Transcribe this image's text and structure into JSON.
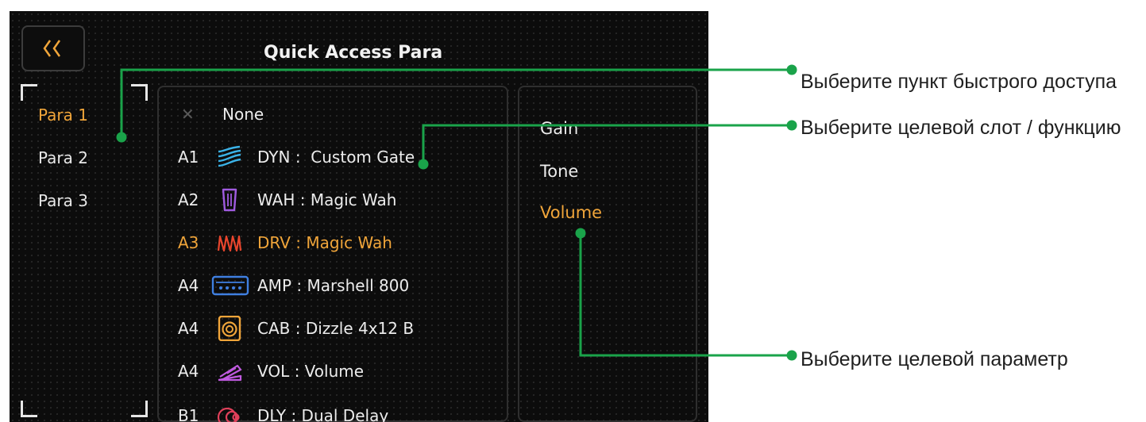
{
  "header": {
    "title": "Quick Access Para",
    "back_label": "‹‹"
  },
  "para_items": [
    {
      "label": "Para 1",
      "selected": true
    },
    {
      "label": "Para 2",
      "selected": false
    },
    {
      "label": "Para 3",
      "selected": false
    }
  ],
  "slots": [
    {
      "code": "",
      "icon": "close-icon",
      "name": "None",
      "selected": false
    },
    {
      "code": "A1",
      "icon": "dyn-wave-icon",
      "name": "DYN :  Custom Gate",
      "selected": false
    },
    {
      "code": "A2",
      "icon": "wah-pedal-icon",
      "name": "WAH : Magic Wah",
      "selected": false
    },
    {
      "code": "A3",
      "icon": "drv-zigzag-icon",
      "name": "DRV : Magic Wah",
      "selected": true
    },
    {
      "code": "A4",
      "icon": "amp-icon",
      "name": "AMP : Marshell 800",
      "selected": false
    },
    {
      "code": "A4",
      "icon": "cab-speaker-icon",
      "name": "CAB : Dizzle 4x12 B",
      "selected": false
    },
    {
      "code": "A4",
      "icon": "vol-pedal-icon",
      "name": "VOL : Volume",
      "selected": false
    },
    {
      "code": "B1",
      "icon": "dly-circles-icon",
      "name": "DLY : Dual Delay",
      "selected": false
    }
  ],
  "params": [
    {
      "label": "Gain",
      "selected": false
    },
    {
      "label": "Tone",
      "selected": false
    },
    {
      "label": "Volume",
      "selected": true
    }
  ],
  "callouts": {
    "quick_access": "Выберите пункт быстрого доступа",
    "target_slot": "Выберите целевой слот / функцию",
    "target_param": "Выберите целевой параметр"
  },
  "colors": {
    "accent": "#f0a53a",
    "callout_line": "#1aa34a",
    "dyn": "#3bb3e8",
    "wah": "#a05be0",
    "drv": "#e8452d",
    "amp": "#3f7fe0",
    "cab": "#f0a53a",
    "vol": "#c05ae0",
    "dly": "#e0405a"
  }
}
